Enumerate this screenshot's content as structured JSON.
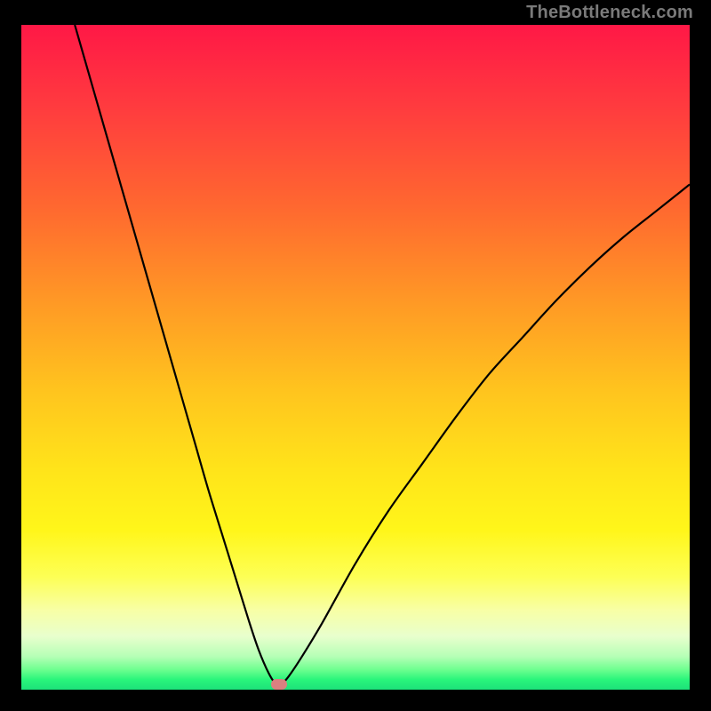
{
  "watermark": "TheBottleneck.com",
  "colors": {
    "frame": "#000000",
    "curve": "#000000",
    "marker": "#d98080"
  },
  "chart_data": {
    "type": "line",
    "title": "",
    "xlabel": "",
    "ylabel": "",
    "xlim": [
      0,
      100
    ],
    "ylim": [
      0,
      100
    ],
    "grid": false,
    "legend": false,
    "series": [
      {
        "name": "bottleneck-curve",
        "x": [
          8,
          10,
          12,
          14,
          16,
          18,
          20,
          22,
          24,
          26,
          28,
          30,
          32,
          34,
          35.5,
          37,
          38,
          39,
          40,
          42,
          45,
          50,
          55,
          60,
          65,
          70,
          75,
          80,
          85,
          90,
          95,
          100
        ],
        "y": [
          100,
          93,
          86,
          79,
          72,
          65,
          58,
          51,
          44,
          37,
          30,
          23.5,
          17,
          10.5,
          6,
          2.5,
          1,
          1,
          2,
          5,
          10,
          19,
          27,
          34,
          41,
          47.5,
          53,
          58.5,
          63.5,
          68,
          72,
          76
        ]
      }
    ],
    "annotations": [
      {
        "name": "optimal-point",
        "x": 38.5,
        "y": 0.8
      }
    ],
    "background_gradient": {
      "direction": "vertical",
      "stops": [
        {
          "pos": 0.0,
          "color": "#ff1846"
        },
        {
          "pos": 0.5,
          "color": "#ffd21a"
        },
        {
          "pos": 0.85,
          "color": "#fbff6a"
        },
        {
          "pos": 1.0,
          "color": "#1de17a"
        }
      ],
      "meaning": "red=high bottleneck, green=balanced"
    }
  }
}
